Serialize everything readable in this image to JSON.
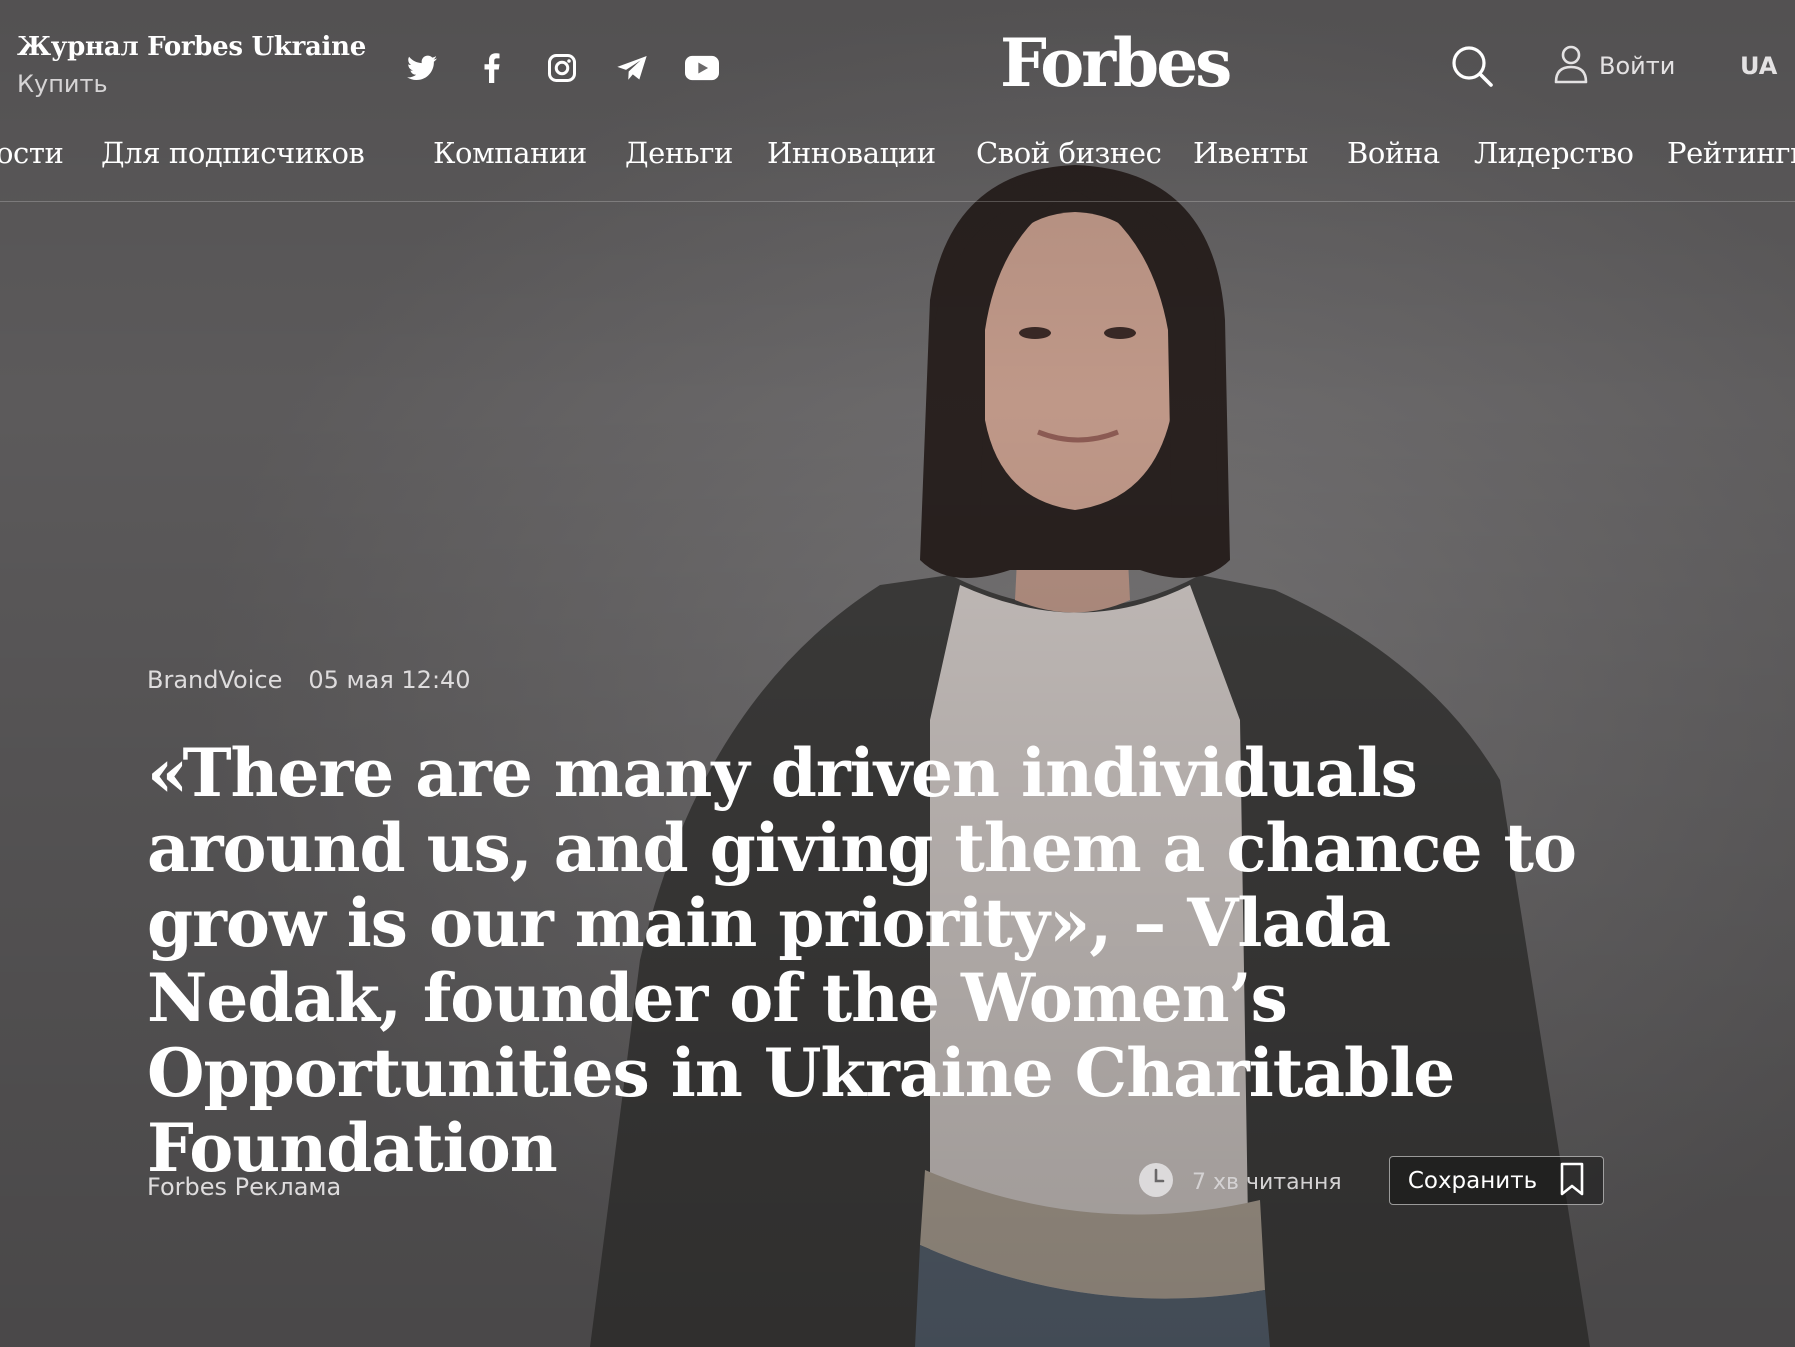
{
  "header": {
    "magazine_title": "Журнал Forbes Ukraine",
    "magazine_buy": "Купить",
    "social_icons": [
      "twitter-icon",
      "facebook-icon",
      "instagram-icon",
      "telegram-icon",
      "youtube-icon"
    ],
    "logo": "Forbes",
    "login_label": "Войти",
    "language": "UA"
  },
  "nav": {
    "items": [
      "ости",
      "Для подписчиков",
      "Компании",
      "Деньги",
      "Инновации",
      "Свой бизнес",
      "Ивенты",
      "Война",
      "Лидерство",
      "Рейтинги"
    ]
  },
  "article": {
    "category": "BrandVoice",
    "date": "05 мая 12:40",
    "headline_bold": "«There are many driven individuals around us, and giving them a chance to grow is our main priority»,",
    "headline_regular": " – Vlada Nedak, founder of the Women’s Opportunities in Ukraine Charitable Foundation",
    "byline": "Forbes Реклама",
    "read_time": "7 хв читання",
    "save_label": "Сохранить"
  }
}
